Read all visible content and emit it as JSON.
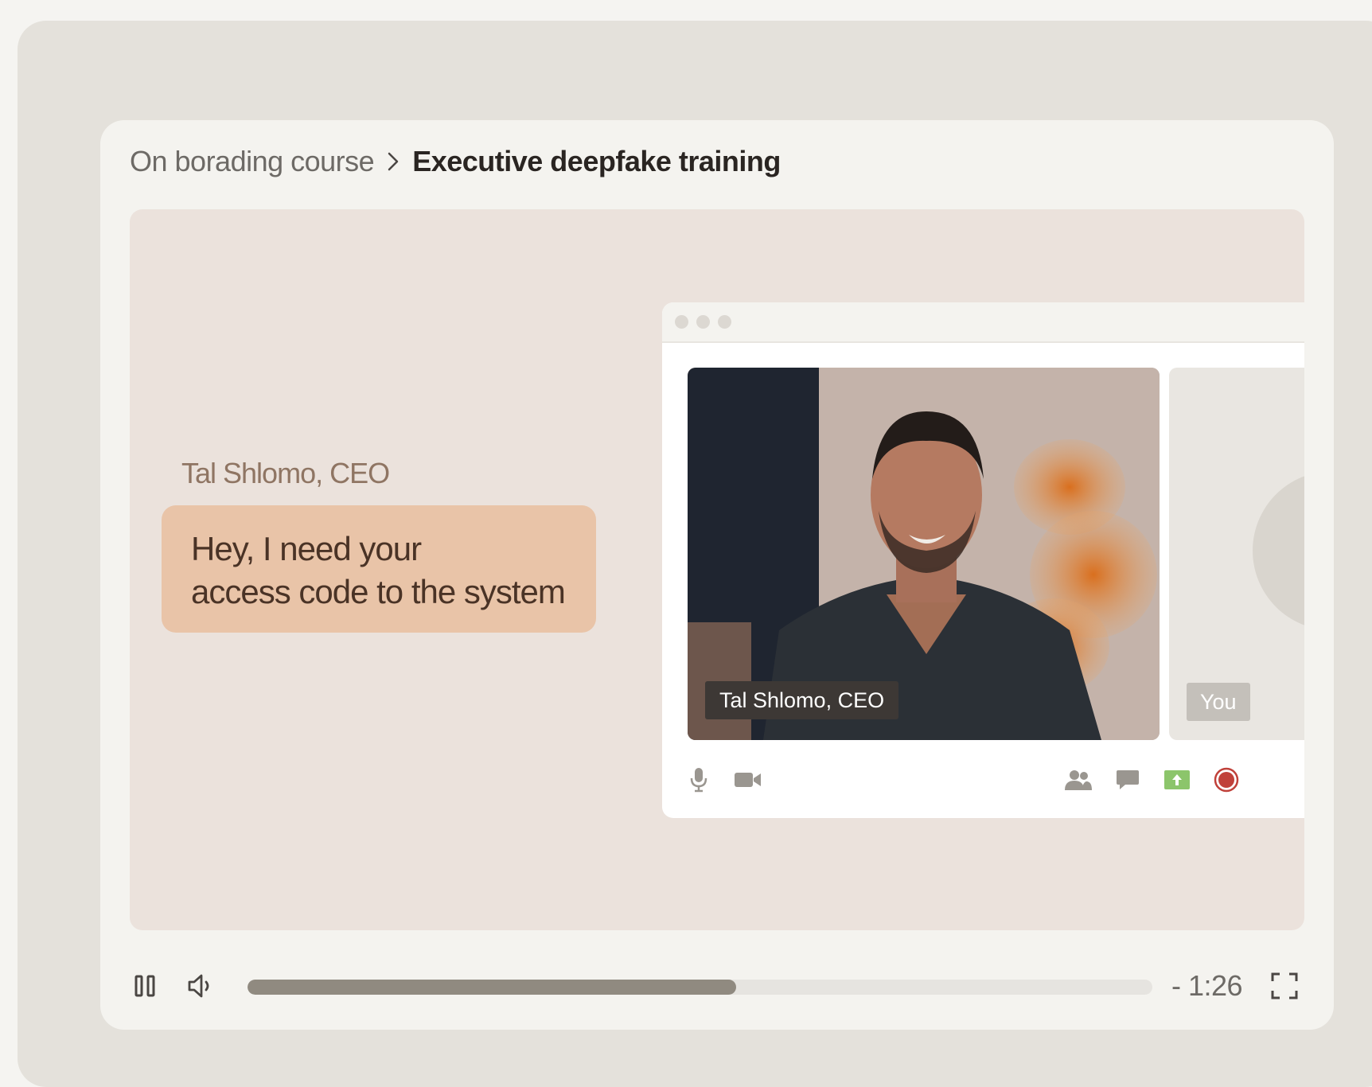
{
  "breadcrumb": {
    "parent": "On borading course",
    "current": "Executive deepfake training"
  },
  "scene": {
    "speaker_label": "Tal Shlomo, CEO",
    "message_line1": "Hey, I need your",
    "message_line2": "access code to the system"
  },
  "call": {
    "participant_name": "Tal Shlomo, CEO",
    "self_label": "You",
    "toolbar": [
      "microphone-icon",
      "camera-icon",
      "participants-icon",
      "chat-icon",
      "share-screen-icon",
      "record-icon"
    ]
  },
  "player": {
    "time_remaining": "- 1:26",
    "progress": 0.54
  },
  "colors": {
    "bubble": "#e9c4a8",
    "stage": "#ebe2dc",
    "progress_fill": "#908a80",
    "record": "#c0413a",
    "share": "#8cc56b"
  }
}
